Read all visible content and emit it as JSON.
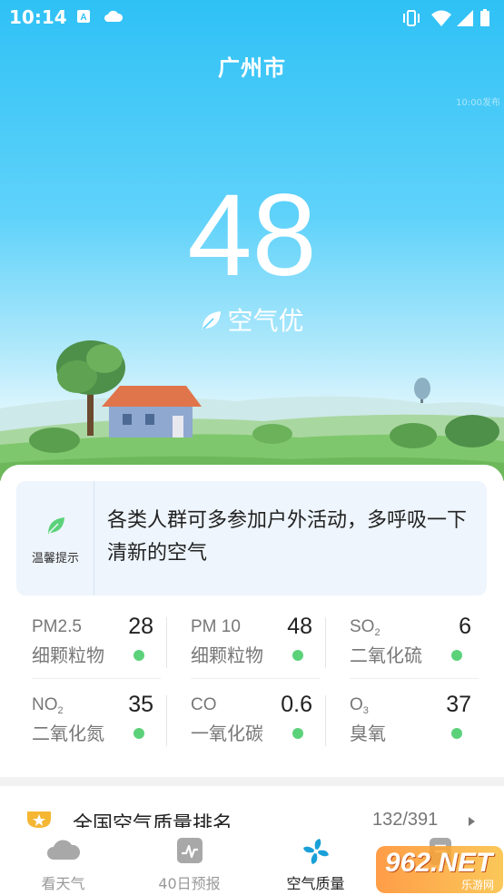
{
  "status_bar": {
    "time": "10:14"
  },
  "header": {
    "city": "广州市",
    "update_time": "10:00发布"
  },
  "air_quality": {
    "aqi": "48",
    "level": "空气优",
    "level_color": "#5bd27a"
  },
  "tip": {
    "label": "温馨提示",
    "text": "各类人群可多参加户外活动，多呼吸一下清新的空气",
    "icon": "leaf-icon"
  },
  "pollutants": [
    {
      "code": "PM2.5",
      "code_sub": "",
      "name": "细颗粒物",
      "value": "28",
      "status_color": "#5bd27a"
    },
    {
      "code": "PM 10",
      "code_sub": "",
      "name": "细颗粒物",
      "value": "48",
      "status_color": "#5bd27a"
    },
    {
      "code": "SO",
      "code_sub": "2",
      "name": "二氧化硫",
      "value": "6",
      "status_color": "#5bd27a"
    },
    {
      "code": "NO",
      "code_sub": "2",
      "name": "二氧化氮",
      "value": "35",
      "status_color": "#5bd27a"
    },
    {
      "code": "CO",
      "code_sub": "",
      "name": "一氧化碳",
      "value": "0.6",
      "status_color": "#5bd27a"
    },
    {
      "code": "O",
      "code_sub": "3",
      "name": "臭氧",
      "value": "37",
      "status_color": "#5bd27a"
    }
  ],
  "ranking": {
    "title": "全国空气质量排名",
    "value": "132/391",
    "icon": "trophy-icon"
  },
  "tabs": [
    {
      "label": "看天气",
      "icon": "cloud-icon",
      "active": false
    },
    {
      "label": "40日预报",
      "icon": "trend-chart-icon",
      "active": false
    },
    {
      "label": "空气质量",
      "icon": "fan-icon",
      "active": true
    },
    {
      "label": "",
      "icon": "document-icon",
      "active": false
    }
  ],
  "watermark": {
    "text": "962.NET",
    "sub": "乐游网"
  }
}
